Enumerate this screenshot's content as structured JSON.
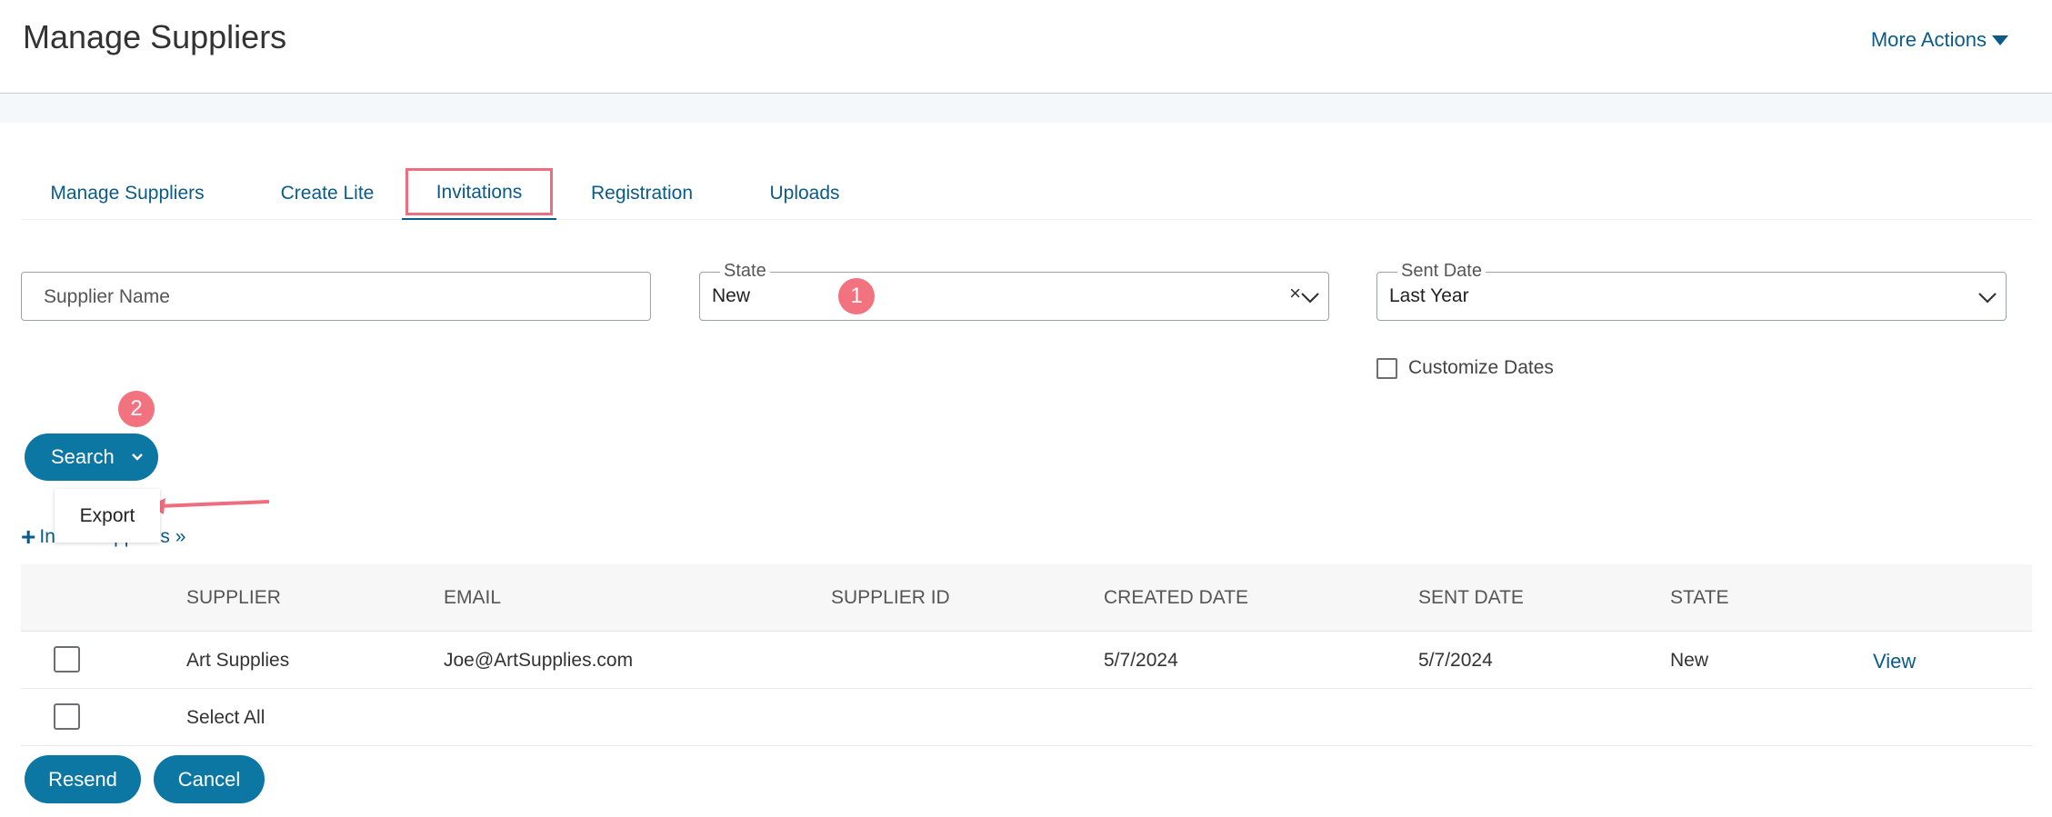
{
  "header": {
    "title": "Manage Suppliers",
    "more_actions": "More Actions"
  },
  "tabs": [
    {
      "label": "Manage Suppliers"
    },
    {
      "label": "Create Lite"
    },
    {
      "label": "Invitations"
    },
    {
      "label": "Registration"
    },
    {
      "label": "Uploads"
    }
  ],
  "filters": {
    "supplier_name_placeholder": "Supplier Name",
    "state": {
      "label": "State",
      "value": "New",
      "clear": "×"
    },
    "sent_date": {
      "label": "Sent Date",
      "value": "Last Year"
    },
    "customize_dates": "Customize Dates"
  },
  "badges": {
    "one": "1",
    "two": "2"
  },
  "search": {
    "label": "Search",
    "menu_item": "Export"
  },
  "invite_link": {
    "icon": "plus-icon",
    "label": "Invite Suppliers »"
  },
  "table": {
    "headers": [
      "SUPPLIER",
      "EMAIL",
      "SUPPLIER ID",
      "CREATED DATE",
      "SENT DATE",
      "STATE"
    ],
    "rows": [
      {
        "supplier": "Art Supplies",
        "email": "Joe@ArtSupplies.com",
        "supplier_id": "",
        "created": "5/7/2024",
        "sent": "5/7/2024",
        "state": "New",
        "action": "View"
      }
    ],
    "select_all": "Select All"
  },
  "actions": {
    "resend": "Resend",
    "cancel": "Cancel"
  },
  "colors": {
    "accent": "#0c77a3",
    "link": "#0a5a8a",
    "highlight": "#ee6e7f",
    "badge": "#f2727f"
  }
}
